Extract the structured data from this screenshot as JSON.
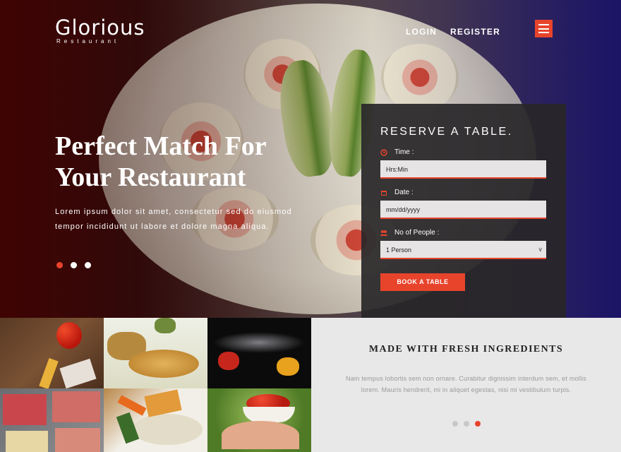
{
  "brand": {
    "name": "Glorious",
    "subtitle": "Restaurant"
  },
  "nav": {
    "login": "LOGIN",
    "register": "REGISTER",
    "menu_icon": "hamburger-menu-icon"
  },
  "hero": {
    "headline_line1": "Perfect Match For",
    "headline_line2": "Your Restaurant",
    "paragraph_line1": "Lorem ipsum dolor sit amet, consectetur sed do eiusmod",
    "paragraph_line2": "tempor incididunt ut labore et dolore magna aliqua.",
    "slides": 3,
    "active_slide": 1
  },
  "reserve": {
    "title": "RESERVE A TABLE.",
    "time_label": "Time :",
    "time_placeholder": "Hrs:Min",
    "date_label": "Date :",
    "date_placeholder": "mm/dd/yyyy",
    "people_label": "No of People :",
    "people_value": "1 Person",
    "button": "BOOK A TABLE"
  },
  "info": {
    "title": "MADE WITH FRESH INGREDIENTS",
    "text_line1": "Nam tempus lobortis sem non ornare. Curabitur dignissim interdum sem, et mollis",
    "text_line2": "lorem. Mauris hendrerit, mi in aliquet egestas, nisi mi vestibulum turpis.",
    "slides": 3,
    "active_slide": 3
  },
  "colors": {
    "accent": "#e8442c",
    "panel": "#2a282a",
    "info_bg": "#e8e8e8"
  }
}
